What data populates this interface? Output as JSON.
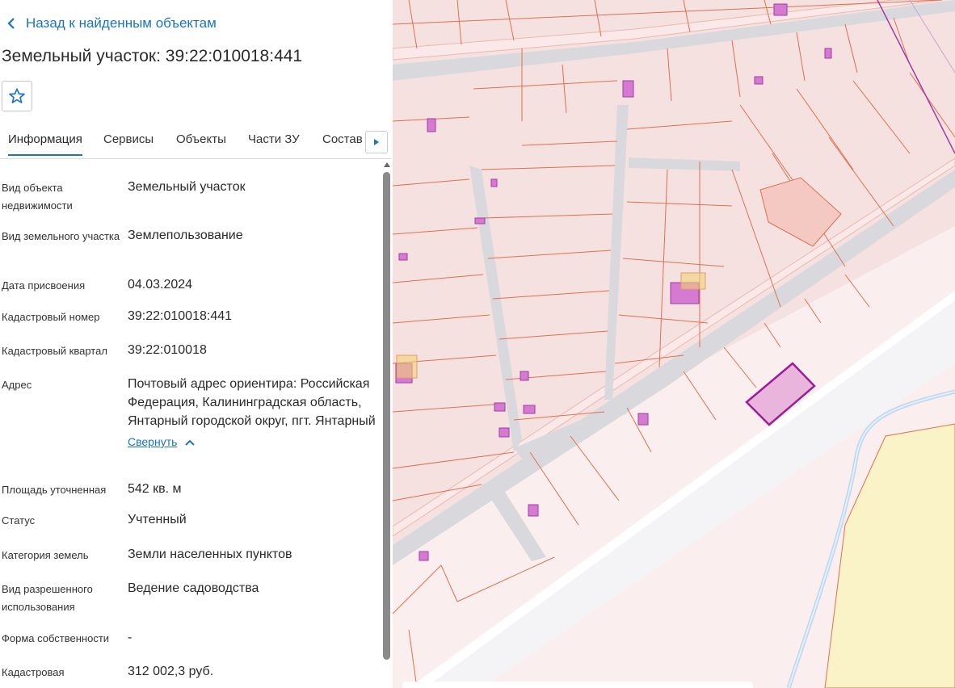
{
  "back_label": "Назад к найденным объектам",
  "title": "Земельный участок: 39:22:010018:441",
  "tabs": [
    "Информация",
    "Сервисы",
    "Объекты",
    "Части ЗУ",
    "Состав"
  ],
  "rows": [
    {
      "label": "Вид объекта недвижимости",
      "value": "Земельный участок"
    },
    {
      "label": "Вид земельного участка",
      "value": "Землепользование"
    },
    {
      "label": "Дата присвоения",
      "value": "04.03.2024"
    },
    {
      "label": "Кадастровый номер",
      "value": "39:22:010018:441"
    },
    {
      "label": "Кадастровый квартал",
      "value": "39:22:010018"
    },
    {
      "label": "Адрес",
      "value": "Почтовый адрес ориентира: Российская Федерация, Калининградская область, Янтарный городской округ, пгт. Янтарный"
    },
    {
      "label": "Площадь уточненная",
      "value": "542 кв. м"
    },
    {
      "label": "Статус",
      "value": "Учтенный"
    },
    {
      "label": "Категория земель",
      "value": "Земли населенных пунктов"
    },
    {
      "label": "Вид разрешенного использования",
      "value": "Ведение садоводства"
    },
    {
      "label": "Форма собственности",
      "value": "-"
    },
    {
      "label": "Кадастровая",
      "value": "312 002,3 руб."
    }
  ],
  "collapse_label": "Свернуть",
  "icons": {
    "back": "chevron-left-icon",
    "favorite": "star-outline-icon",
    "tab_next": "caret-right-icon",
    "collapse": "chevron-up-icon"
  },
  "colors": {
    "accent": "#1a73c7",
    "parcel_fill": "#f6e1e1",
    "parcel_line": "#e0704f",
    "road": "#d8d8dc",
    "building": "#d47ad0",
    "selected_parcel": "#9b1f9b",
    "water": "#b9d6f3",
    "forest": "#faf3c8"
  }
}
